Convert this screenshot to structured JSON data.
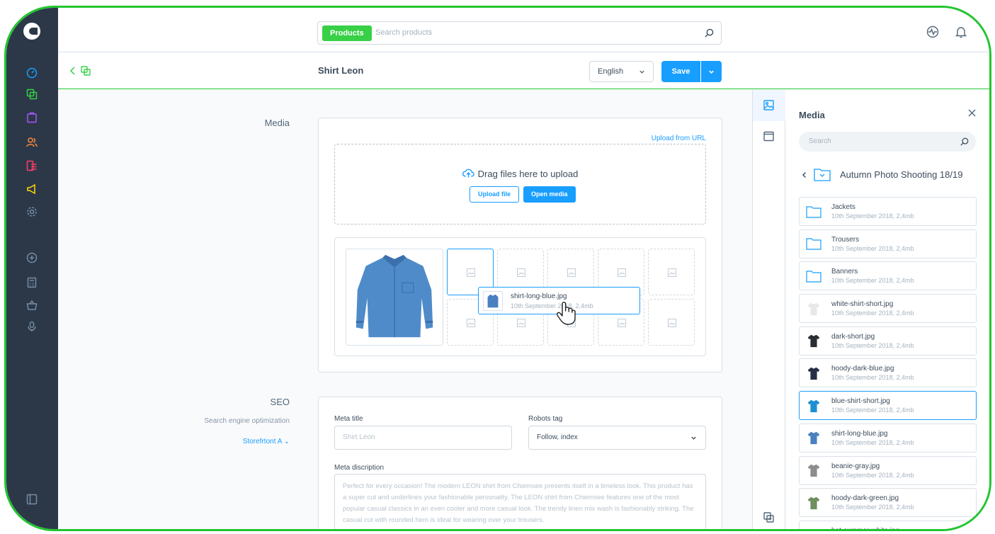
{
  "search": {
    "scope": "Products",
    "placeholder": "Search products"
  },
  "header": {
    "title": "Shirt Leon",
    "language": "English",
    "save_label": "Save"
  },
  "media_section": {
    "label": "Media",
    "upload_url": "Upload from URL",
    "drop_text": "Drag files here to upload",
    "upload_file": "Upload file",
    "open_media": "Open media",
    "dragging": {
      "name": "shirt-long-blue.jpg",
      "meta": "10th September 2018, 2,4mb"
    }
  },
  "seo_section": {
    "label": "SEO",
    "sublabel": "Search engine optimization",
    "storefront": "Storefrtont A",
    "meta_title_label": "Meta title",
    "meta_title_placeholder": "Shirt Leon",
    "robots_label": "Robots tag",
    "robots_value": "Follow, index",
    "meta_desc_label": "Meta discription",
    "meta_desc_text": "Perfect for every occasion! The modern LEON shirt from Chiemsee presents itself in a timeless look. This product has a super cut and underlines your fashionable personality. The LEON shirt from Chiemsee features one of the most popular casual classics in an even cooler and more casual look. The trendy linen mix wash is fashionably striking. The casual cut with rounded hem is ideal for wearing over your trousers."
  },
  "media_panel": {
    "title": "Media",
    "search_placeholder": "Search",
    "folder": "Autumn Photo Shooting 18/19",
    "items": [
      {
        "name": "Jackets",
        "meta": "10th September 2018, 2,4mb",
        "kind": "folder"
      },
      {
        "name": "Trousers",
        "meta": "10th September 2018, 2,4mb",
        "kind": "folder"
      },
      {
        "name": "Banners",
        "meta": "10th September 2018, 2,4mb",
        "kind": "folder"
      },
      {
        "name": "white-shirt-short.jpg",
        "meta": "10th September 2018, 2,4mb",
        "kind": "image",
        "color": "#e8e8e8"
      },
      {
        "name": "dark-short.jpg",
        "meta": "10th September 2018, 2,4mb",
        "kind": "image",
        "color": "#2a2d33"
      },
      {
        "name": "hoody-dark-blue.jpg",
        "meta": "10th September 2018, 2,4mb",
        "kind": "image",
        "color": "#262d45"
      },
      {
        "name": "blue-shirt-short.jpg",
        "meta": "10th September 2018, 2,4mb",
        "kind": "image",
        "color": "#1d8fd1"
      },
      {
        "name": "shirt-long-blue.jpg",
        "meta": "10th September 2018, 2,4mb",
        "kind": "image",
        "color": "#4a80c0"
      },
      {
        "name": "beanie-gray.jpg",
        "meta": "10th September 2018, 2,4mb",
        "kind": "image",
        "color": "#8d8d8d"
      },
      {
        "name": "hoody-dark-green.jpg",
        "meta": "10th September 2018, 2,4mb",
        "kind": "image",
        "color": "#6f8f5e"
      },
      {
        "name": "hat-summer-white.jpg",
        "meta": "",
        "kind": "image",
        "color": "#e6ddd0"
      }
    ],
    "selected_index": 6
  },
  "colors": {
    "accent": "#189eff",
    "nav_bg": "#2c3848",
    "green": "#37d046"
  }
}
